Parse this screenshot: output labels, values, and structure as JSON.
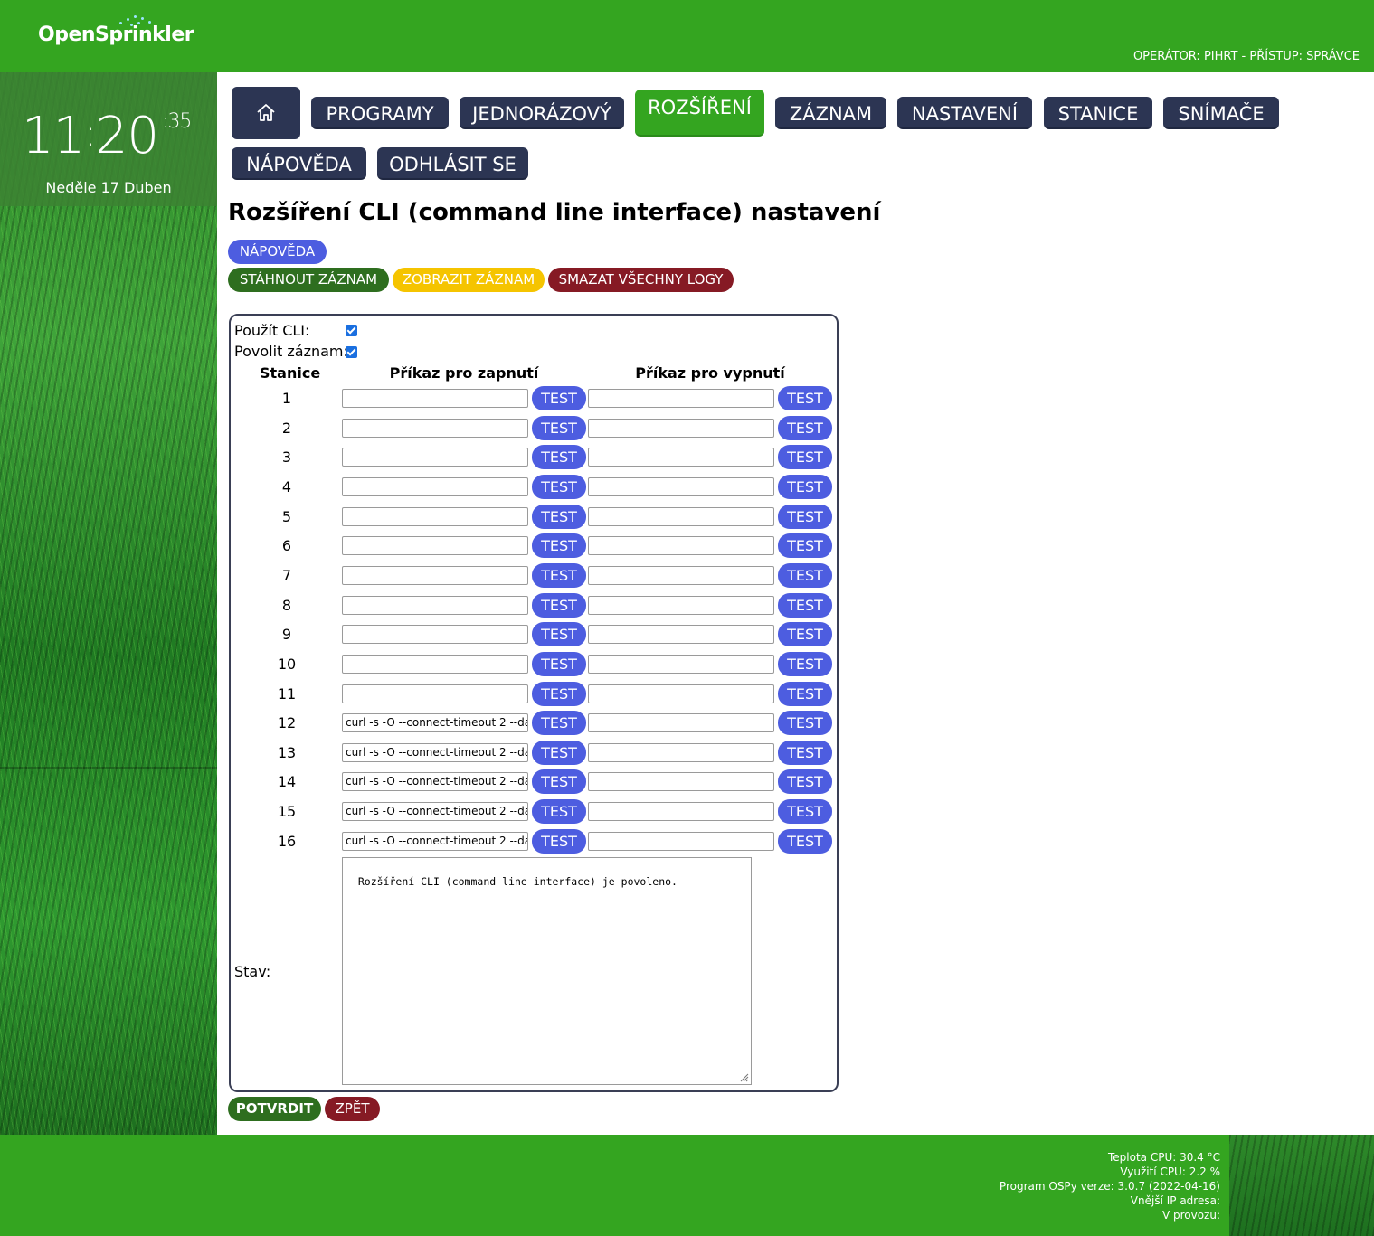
{
  "app": {
    "logo_text": "OpenSprinkler",
    "operator_text": "OPERÁTOR: PIHRT - PŘÍSTUP: SPRÁVCE"
  },
  "clock": {
    "hours": "11",
    "minutes": "20",
    "seconds": "35",
    "date": "Neděle 17 Duben"
  },
  "nav": {
    "home_icon": "home-icon",
    "programs": "PROGRAMY",
    "run_once": "JEDNORÁZOVÝ",
    "plugins": "ROZŠÍŘENÍ",
    "log": "ZÁZNAM",
    "settings": "NASTAVENÍ",
    "stations": "STANICE",
    "sensors": "SNÍMAČE",
    "help": "NÁPOVĚDA",
    "logout": "ODHLÁSIT SE"
  },
  "page": {
    "title": "Rozšíření CLI (command line interface) nastavení",
    "help_button": "NÁPOVĚDA",
    "download_log": "STÁHNOUT ZÁZNAM",
    "show_log": "ZOBRAZIT ZÁZNAM",
    "delete_logs": "SMAZAT VŠECHNY LOGY"
  },
  "form": {
    "use_cli_label": "Použít CLI:",
    "use_cli_checked": true,
    "enable_log_label": "Povolit záznam:",
    "enable_log_checked": true,
    "col_station": "Stanice",
    "col_on": "Příkaz pro zapnutí",
    "col_off": "Příkaz pro vypnutí",
    "test_label": "TEST",
    "stations": [
      {
        "num": "1",
        "on": "",
        "off": ""
      },
      {
        "num": "2",
        "on": "",
        "off": ""
      },
      {
        "num": "3",
        "on": "",
        "off": ""
      },
      {
        "num": "4",
        "on": "",
        "off": ""
      },
      {
        "num": "5",
        "on": "",
        "off": ""
      },
      {
        "num": "6",
        "on": "",
        "off": ""
      },
      {
        "num": "7",
        "on": "",
        "off": ""
      },
      {
        "num": "8",
        "on": "",
        "off": ""
      },
      {
        "num": "9",
        "on": "",
        "off": ""
      },
      {
        "num": "10",
        "on": "",
        "off": ""
      },
      {
        "num": "11",
        "on": "",
        "off": ""
      },
      {
        "num": "12",
        "on": "curl -s -O --connect-timeout 2 --da",
        "off": ""
      },
      {
        "num": "13",
        "on": "curl -s -O --connect-timeout 2 --da",
        "off": ""
      },
      {
        "num": "14",
        "on": "curl -s -O --connect-timeout 2 --da",
        "off": ""
      },
      {
        "num": "15",
        "on": "curl -s -O --connect-timeout 2 --da",
        "off": ""
      },
      {
        "num": "16",
        "on": "curl -s -O --connect-timeout 2 --da",
        "off": ""
      }
    ],
    "status_label": "Stav:",
    "status_text": "Rozšíření CLI (command line interface) je povoleno.",
    "confirm": "POTVRDIT",
    "back": "ZPĚT"
  },
  "footer": {
    "cpu_temp": "Teplota CPU: 30.4 °C",
    "cpu_usage": "Využití CPU: 2.2 %",
    "version": "Program OSPy verze: 3.0.7 (2022-04-16)",
    "external_ip": "Vnější IP adresa:",
    "uptime": "V provozu:"
  },
  "colors": {
    "header_green": "#34a520",
    "nav_dark": "#2c3553",
    "test_blue": "#4d5de0",
    "danger_red": "#861a24",
    "warn_yellow": "#f5c400"
  }
}
